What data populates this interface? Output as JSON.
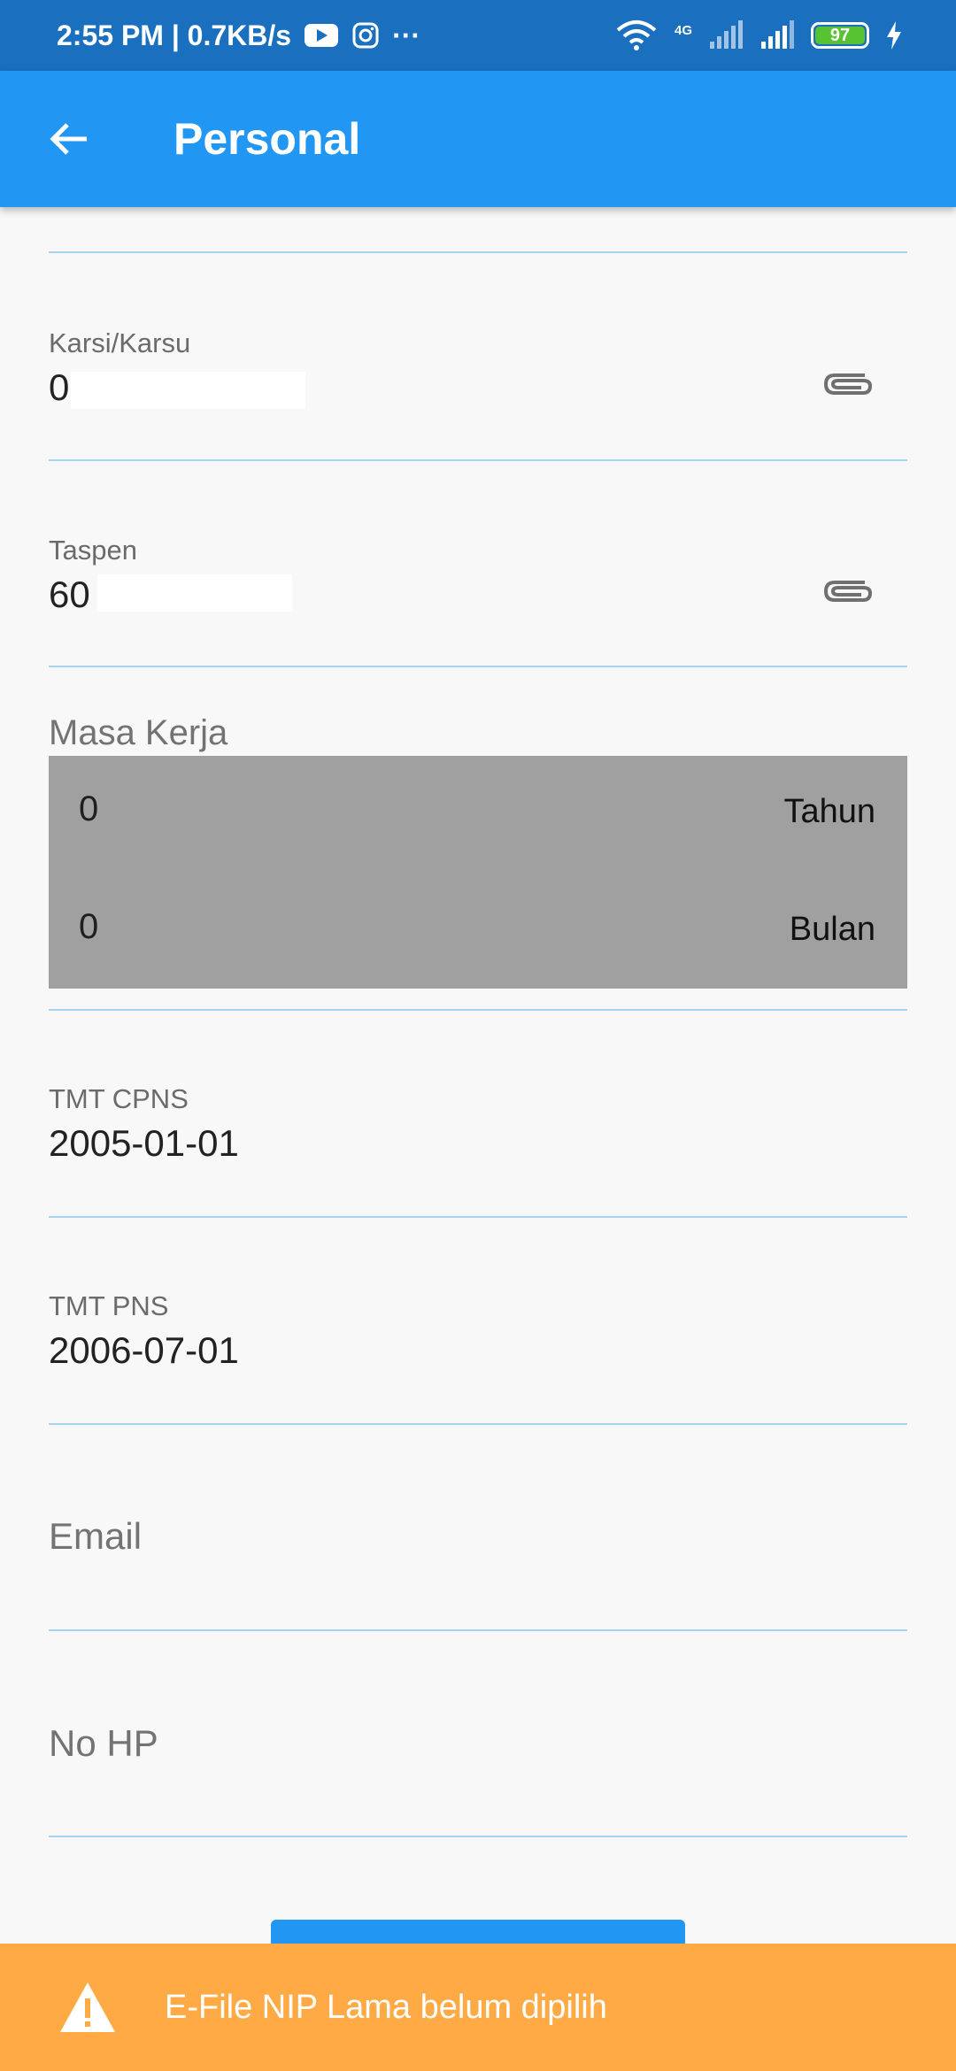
{
  "status_bar": {
    "time_speed": "2:55 PM | 0.7KB/s",
    "more_dots": "···",
    "network_label": "4G",
    "battery": "97"
  },
  "app_bar": {
    "title": "Personal"
  },
  "fields": {
    "karsi": {
      "label": "Karsi/Karsu",
      "value": "0"
    },
    "taspen": {
      "label": "Taspen",
      "value": "60"
    },
    "masa_kerja": {
      "label": "Masa Kerja",
      "tahun_value": "0",
      "tahun_unit": "Tahun",
      "bulan_value": "0",
      "bulan_unit": "Bulan"
    },
    "tmt_cpns": {
      "label": "TMT CPNS",
      "value": "2005-01-01"
    },
    "tmt_pns": {
      "label": "TMT PNS",
      "value": "2006-07-01"
    },
    "email": {
      "hint": "Email"
    },
    "no_hp": {
      "hint": "No HP"
    }
  },
  "snackbar": {
    "message": "E-File NIP Lama belum dipilih"
  },
  "icons": {
    "back": "arrow-left-icon",
    "attachment": "paperclip-icon",
    "warning": "warning-triangle-icon"
  },
  "colors": {
    "status_bar": "#1a6fbf",
    "app_bar": "#2196f3",
    "divider": "#a6d4ee",
    "masa_box": "#a0a0a0",
    "snackbar": "#ffaa45"
  }
}
